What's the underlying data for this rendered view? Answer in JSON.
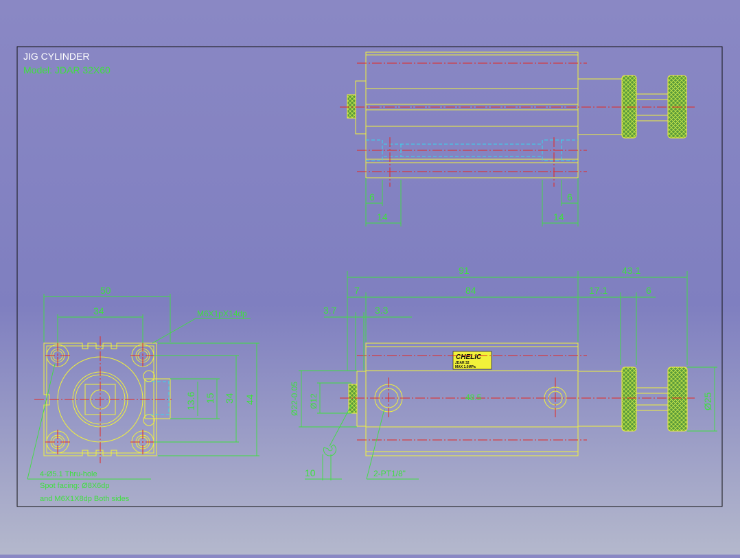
{
  "drawing": {
    "title": "JIG CYLINDER",
    "model": "Model: JDAR 32X60"
  },
  "colors": {
    "background": "#8080c0",
    "outline": "#f2f23a",
    "dimension": "#3ee03e",
    "center_line": "#e8261e",
    "hidden_line": "#35d8ee"
  },
  "top_view": {
    "dims": {
      "port_offset_left": "6",
      "port_offset_right": "6",
      "port_span_left": "14",
      "port_span_right": "14"
    }
  },
  "end_view": {
    "dims": {
      "width": "50",
      "bolt_spacing": "34",
      "height": "44",
      "bolt_spacing_v": "34",
      "port_h1": "13.6",
      "port_h2": "15"
    },
    "thread_note": "M6X1pX14dp",
    "notes": [
      "4-Ø5.1 Thru-hole",
      "Spot facing: Ø8X6dp",
      "and M6X1X8dp Both sides"
    ]
  },
  "side_view": {
    "dims": {
      "overall": "91",
      "rod_extension": "43.1",
      "flange": "7",
      "body": "84",
      "rod_to_knob": "17.1",
      "knob_width": "6",
      "face_a": "3.7",
      "face_b": "3.3",
      "rod_dia": "Ø12",
      "boss_dia": "Ø22-0.05",
      "knob_dia": "Ø25",
      "wrench": "10"
    },
    "center_label": "48.5",
    "port_note": "2-PT1/8\"",
    "nameplate": {
      "brand": "CHELIC",
      "line1": "JDAR 32",
      "line2": "MAX 1.0MPa"
    }
  }
}
